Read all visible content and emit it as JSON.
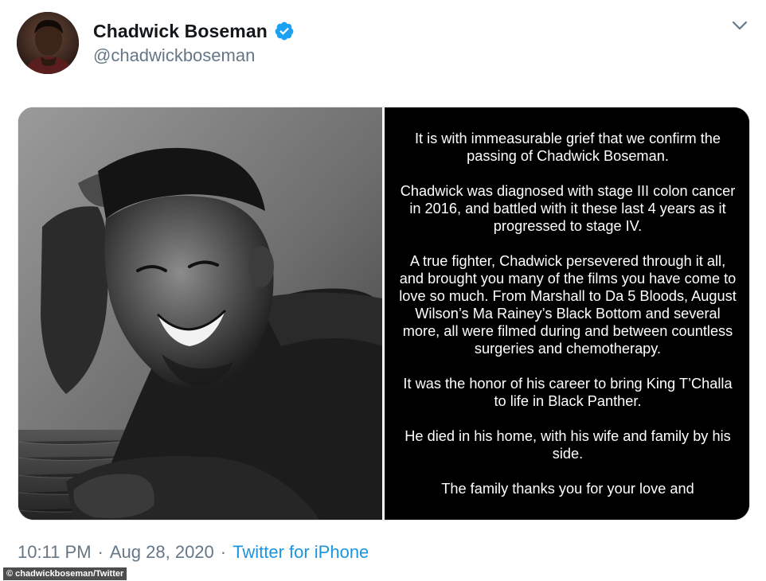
{
  "tweet": {
    "author": {
      "display_name": "Chadwick Boseman",
      "handle": "@chadwickboseman",
      "verified": true,
      "avatar_icon": "profile-photo-avatar",
      "verified_color": "#1da1f2"
    },
    "menu_icon": "chevron-down-icon",
    "media": {
      "photo_icon": "black-and-white-portrait-photo",
      "statement_paragraphs": [
        "It is with immeasurable grief that we confirm the passing of Chadwick Boseman.",
        "Chadwick was diagnosed with stage III colon cancer in 2016, and battled with it these last 4 years as it progressed to stage IV.",
        "A true fighter, Chadwick persevered through it all, and brought you many of the films you have come to love so much. From Marshall to Da 5 Bloods, August Wilson’s Ma Rainey’s Black Bottom and several more, all were filmed during and between countless surgeries and chemotherapy.",
        "It was the honor of his career to bring King T’Challa to life in Black Panther.",
        "He died in his home, with his wife and family by his side.",
        "The family thanks you for your love and"
      ]
    },
    "meta": {
      "time": "10:11 PM",
      "separator": "·",
      "date": "Aug 28, 2020",
      "source": "Twitter for iPhone",
      "link_color": "#1b95e0"
    }
  },
  "image_credit": "© chadwickboseman/Twitter"
}
